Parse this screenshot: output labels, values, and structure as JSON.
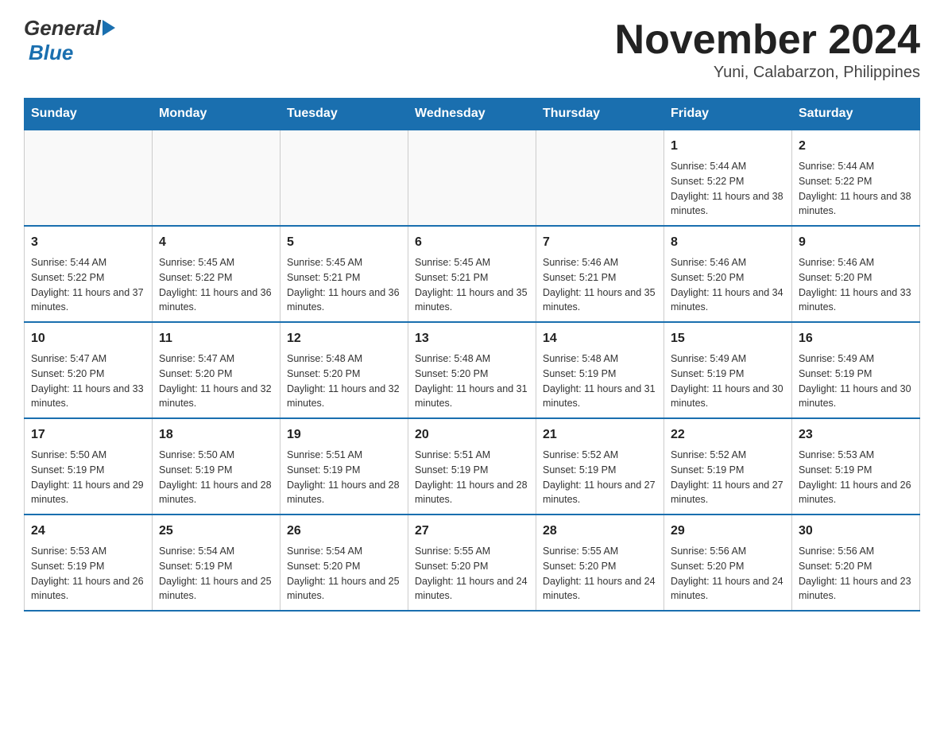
{
  "logo": {
    "general": "General",
    "blue": "Blue"
  },
  "header": {
    "month": "November 2024",
    "location": "Yuni, Calabarzon, Philippines"
  },
  "weekdays": [
    "Sunday",
    "Monday",
    "Tuesday",
    "Wednesday",
    "Thursday",
    "Friday",
    "Saturday"
  ],
  "weeks": [
    [
      {
        "day": "",
        "info": ""
      },
      {
        "day": "",
        "info": ""
      },
      {
        "day": "",
        "info": ""
      },
      {
        "day": "",
        "info": ""
      },
      {
        "day": "",
        "info": ""
      },
      {
        "day": "1",
        "info": "Sunrise: 5:44 AM\nSunset: 5:22 PM\nDaylight: 11 hours and 38 minutes."
      },
      {
        "day": "2",
        "info": "Sunrise: 5:44 AM\nSunset: 5:22 PM\nDaylight: 11 hours and 38 minutes."
      }
    ],
    [
      {
        "day": "3",
        "info": "Sunrise: 5:44 AM\nSunset: 5:22 PM\nDaylight: 11 hours and 37 minutes."
      },
      {
        "day": "4",
        "info": "Sunrise: 5:45 AM\nSunset: 5:22 PM\nDaylight: 11 hours and 36 minutes."
      },
      {
        "day": "5",
        "info": "Sunrise: 5:45 AM\nSunset: 5:21 PM\nDaylight: 11 hours and 36 minutes."
      },
      {
        "day": "6",
        "info": "Sunrise: 5:45 AM\nSunset: 5:21 PM\nDaylight: 11 hours and 35 minutes."
      },
      {
        "day": "7",
        "info": "Sunrise: 5:46 AM\nSunset: 5:21 PM\nDaylight: 11 hours and 35 minutes."
      },
      {
        "day": "8",
        "info": "Sunrise: 5:46 AM\nSunset: 5:20 PM\nDaylight: 11 hours and 34 minutes."
      },
      {
        "day": "9",
        "info": "Sunrise: 5:46 AM\nSunset: 5:20 PM\nDaylight: 11 hours and 33 minutes."
      }
    ],
    [
      {
        "day": "10",
        "info": "Sunrise: 5:47 AM\nSunset: 5:20 PM\nDaylight: 11 hours and 33 minutes."
      },
      {
        "day": "11",
        "info": "Sunrise: 5:47 AM\nSunset: 5:20 PM\nDaylight: 11 hours and 32 minutes."
      },
      {
        "day": "12",
        "info": "Sunrise: 5:48 AM\nSunset: 5:20 PM\nDaylight: 11 hours and 32 minutes."
      },
      {
        "day": "13",
        "info": "Sunrise: 5:48 AM\nSunset: 5:20 PM\nDaylight: 11 hours and 31 minutes."
      },
      {
        "day": "14",
        "info": "Sunrise: 5:48 AM\nSunset: 5:19 PM\nDaylight: 11 hours and 31 minutes."
      },
      {
        "day": "15",
        "info": "Sunrise: 5:49 AM\nSunset: 5:19 PM\nDaylight: 11 hours and 30 minutes."
      },
      {
        "day": "16",
        "info": "Sunrise: 5:49 AM\nSunset: 5:19 PM\nDaylight: 11 hours and 30 minutes."
      }
    ],
    [
      {
        "day": "17",
        "info": "Sunrise: 5:50 AM\nSunset: 5:19 PM\nDaylight: 11 hours and 29 minutes."
      },
      {
        "day": "18",
        "info": "Sunrise: 5:50 AM\nSunset: 5:19 PM\nDaylight: 11 hours and 28 minutes."
      },
      {
        "day": "19",
        "info": "Sunrise: 5:51 AM\nSunset: 5:19 PM\nDaylight: 11 hours and 28 minutes."
      },
      {
        "day": "20",
        "info": "Sunrise: 5:51 AM\nSunset: 5:19 PM\nDaylight: 11 hours and 28 minutes."
      },
      {
        "day": "21",
        "info": "Sunrise: 5:52 AM\nSunset: 5:19 PM\nDaylight: 11 hours and 27 minutes."
      },
      {
        "day": "22",
        "info": "Sunrise: 5:52 AM\nSunset: 5:19 PM\nDaylight: 11 hours and 27 minutes."
      },
      {
        "day": "23",
        "info": "Sunrise: 5:53 AM\nSunset: 5:19 PM\nDaylight: 11 hours and 26 minutes."
      }
    ],
    [
      {
        "day": "24",
        "info": "Sunrise: 5:53 AM\nSunset: 5:19 PM\nDaylight: 11 hours and 26 minutes."
      },
      {
        "day": "25",
        "info": "Sunrise: 5:54 AM\nSunset: 5:19 PM\nDaylight: 11 hours and 25 minutes."
      },
      {
        "day": "26",
        "info": "Sunrise: 5:54 AM\nSunset: 5:20 PM\nDaylight: 11 hours and 25 minutes."
      },
      {
        "day": "27",
        "info": "Sunrise: 5:55 AM\nSunset: 5:20 PM\nDaylight: 11 hours and 24 minutes."
      },
      {
        "day": "28",
        "info": "Sunrise: 5:55 AM\nSunset: 5:20 PM\nDaylight: 11 hours and 24 minutes."
      },
      {
        "day": "29",
        "info": "Sunrise: 5:56 AM\nSunset: 5:20 PM\nDaylight: 11 hours and 24 minutes."
      },
      {
        "day": "30",
        "info": "Sunrise: 5:56 AM\nSunset: 5:20 PM\nDaylight: 11 hours and 23 minutes."
      }
    ]
  ]
}
